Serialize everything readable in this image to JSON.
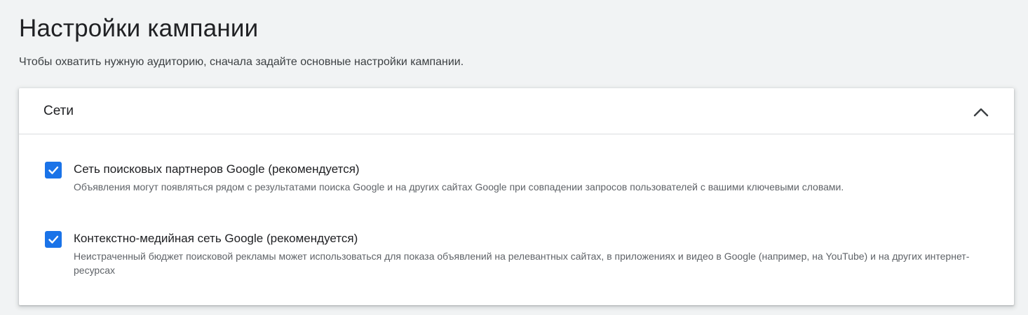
{
  "page": {
    "title": "Настройки кампании",
    "subtitle": "Чтобы охватить нужную аудиторию, сначала задайте основные настройки кампании."
  },
  "networks_card": {
    "title": "Сети",
    "expanded": true,
    "collapse_icon": "chevron-up-icon",
    "accent_color": "#1a73e8",
    "options": [
      {
        "label": "Сеть поисковых партнеров Google (рекомендуется)",
        "description": "Объявления могут появляться рядом с результатами поиска Google и на других сайтах Google при совпадении запросов пользователей с вашими ключевыми словами.",
        "checked": true
      },
      {
        "label": "Контекстно-медийная сеть Google (рекомендуется)",
        "description": "Неистраченный бюджет поисковой рекламы может использоваться для показа объявлений на релевантных сайтах, в приложениях и видео в Google (например, на YouTube) и на других интернет-ресурсах",
        "checked": true
      }
    ]
  }
}
